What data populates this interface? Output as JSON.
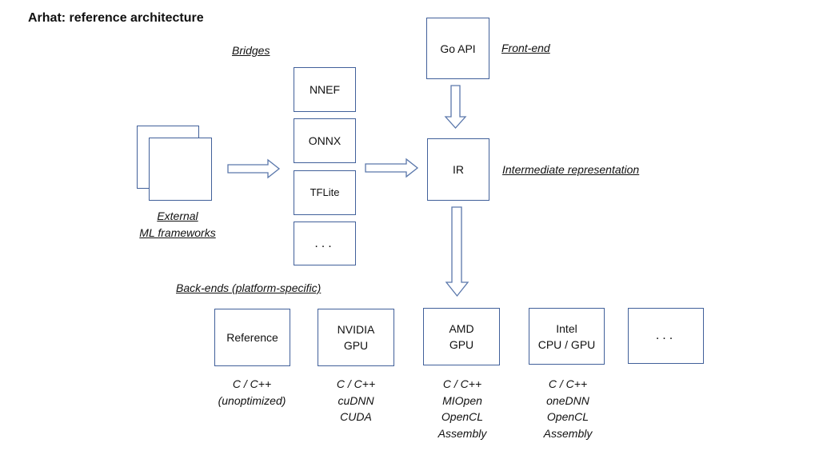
{
  "title": "Arhat: reference architecture",
  "sections": {
    "bridges": "Bridges",
    "front_end": "Front-end",
    "intermediate": "Intermediate representation",
    "back_ends": "Back-ends (platform-specific)"
  },
  "external": {
    "line1": "External",
    "line2": "ML frameworks"
  },
  "bridges": [
    "NNEF",
    "ONNX",
    "TFLite",
    "..."
  ],
  "front_end_box": "Go API",
  "ir_box": "IR",
  "backends": [
    {
      "lines": [
        "Reference"
      ],
      "details": [
        "C / C++",
        "(unoptimized)"
      ]
    },
    {
      "lines": [
        "NVIDIA",
        "GPU"
      ],
      "details": [
        "C / C++",
        "cuDNN",
        "CUDA"
      ]
    },
    {
      "lines": [
        "AMD",
        "GPU"
      ],
      "details": [
        "C / C++",
        "MIOpen",
        "OpenCL",
        "Assembly"
      ]
    },
    {
      "lines": [
        "Intel",
        "CPU / GPU"
      ],
      "details": [
        "C / C++",
        "oneDNN",
        "OpenCL",
        "Assembly"
      ]
    },
    {
      "lines": [
        "..."
      ],
      "details": []
    }
  ],
  "colors": {
    "box_border": "#41609a",
    "arrow_border": "#5a77ab"
  }
}
